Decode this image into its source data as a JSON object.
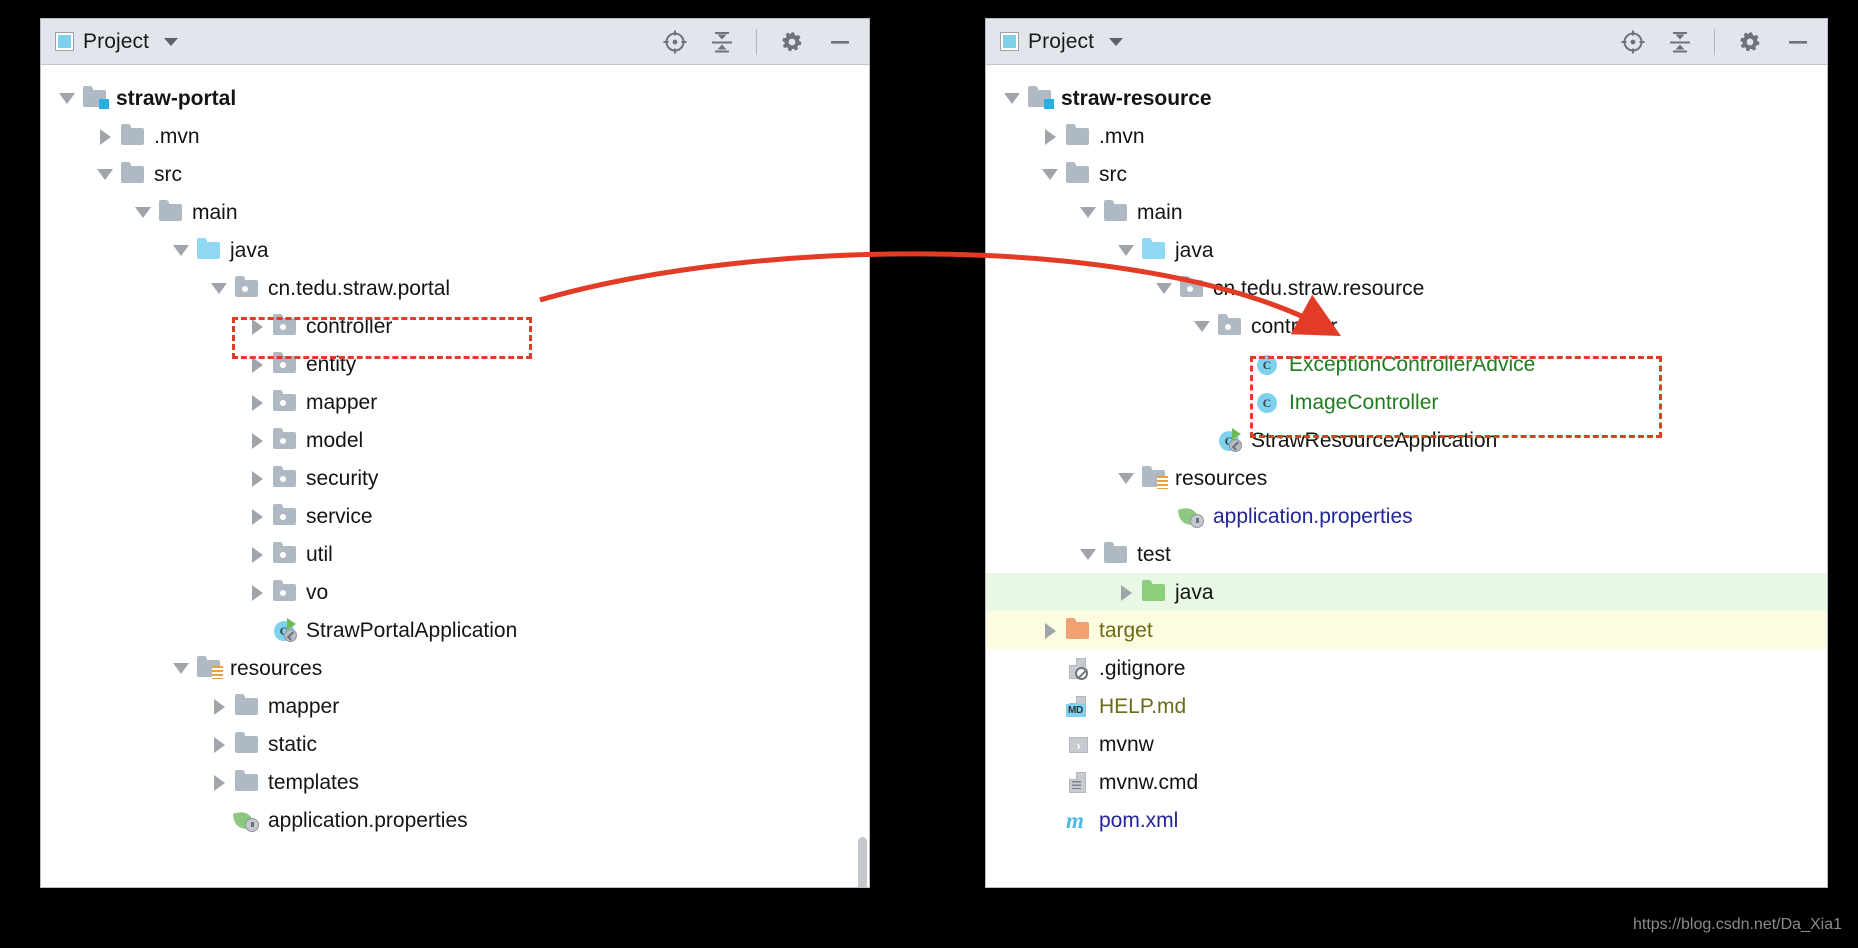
{
  "watermark": "https://blog.csdn.net/Da_Xia1",
  "accent_colors": {
    "header_bg": "#e2e5ec",
    "highlight_box": "#e23b26",
    "arrow": "#e23b26",
    "added_file_text": "#1f7d1f",
    "modified_file_text": "#23239c",
    "ignored_file_text": "#6b6b18",
    "test_row_bg": "#e9f7e5",
    "target_row_bg": "#fdfbe0"
  },
  "left_panel": {
    "header": {
      "icon": "project-window-icon",
      "title": "Project",
      "dropdown": "chevron-down-icon",
      "actions": [
        {
          "name": "select-opened-file-icon",
          "glyph": "crosshair"
        },
        {
          "name": "collapse-all-icon",
          "glyph": "collapse"
        },
        {
          "name": "settings-gear-icon",
          "glyph": "gear"
        },
        {
          "name": "hide-panel-icon",
          "glyph": "minus"
        }
      ]
    },
    "tree": [
      {
        "label": "straw-portal",
        "depth": 0,
        "twisty": "open",
        "icon": "module-folder",
        "bold": true
      },
      {
        "label": ".mvn",
        "depth": 1,
        "twisty": "closed",
        "icon": "folder"
      },
      {
        "label": "src",
        "depth": 1,
        "twisty": "open",
        "icon": "folder"
      },
      {
        "label": "main",
        "depth": 2,
        "twisty": "open",
        "icon": "folder"
      },
      {
        "label": "java",
        "depth": 3,
        "twisty": "open",
        "icon": "source-folder"
      },
      {
        "label": "cn.tedu.straw.portal",
        "depth": 4,
        "twisty": "open",
        "icon": "package-folder"
      },
      {
        "label": "controller",
        "depth": 5,
        "twisty": "closed",
        "icon": "package-folder"
      },
      {
        "label": "entity",
        "depth": 5,
        "twisty": "closed",
        "icon": "package-folder"
      },
      {
        "label": "mapper",
        "depth": 5,
        "twisty": "closed",
        "icon": "package-folder"
      },
      {
        "label": "model",
        "depth": 5,
        "twisty": "closed",
        "icon": "package-folder"
      },
      {
        "label": "security",
        "depth": 5,
        "twisty": "closed",
        "icon": "package-folder"
      },
      {
        "label": "service",
        "depth": 5,
        "twisty": "closed",
        "icon": "package-folder"
      },
      {
        "label": "util",
        "depth": 5,
        "twisty": "closed",
        "icon": "package-folder"
      },
      {
        "label": "vo",
        "depth": 5,
        "twisty": "closed",
        "icon": "package-folder"
      },
      {
        "label": "StrawPortalApplication",
        "depth": 5,
        "twisty": "none",
        "icon": "spring-class"
      },
      {
        "label": "resources",
        "depth": 3,
        "twisty": "open",
        "icon": "resources-folder"
      },
      {
        "label": "mapper",
        "depth": 4,
        "twisty": "closed",
        "icon": "folder"
      },
      {
        "label": "static",
        "depth": 4,
        "twisty": "closed",
        "icon": "folder"
      },
      {
        "label": "templates",
        "depth": 4,
        "twisty": "closed",
        "icon": "folder"
      },
      {
        "label": "application.properties",
        "depth": 4,
        "twisty": "none",
        "icon": "spring-properties"
      }
    ],
    "highlight": {
      "target_label": "controller"
    }
  },
  "right_panel": {
    "header": {
      "icon": "project-window-icon",
      "title": "Project",
      "dropdown": "chevron-down-icon",
      "actions": [
        {
          "name": "select-opened-file-icon",
          "glyph": "crosshair"
        },
        {
          "name": "collapse-all-icon",
          "glyph": "collapse"
        },
        {
          "name": "settings-gear-icon",
          "glyph": "gear"
        },
        {
          "name": "hide-panel-icon",
          "glyph": "minus"
        }
      ]
    },
    "tree": [
      {
        "label": "straw-resource",
        "depth": 0,
        "twisty": "open",
        "icon": "module-folder",
        "bold": true
      },
      {
        "label": ".mvn",
        "depth": 1,
        "twisty": "closed",
        "icon": "folder"
      },
      {
        "label": "src",
        "depth": 1,
        "twisty": "open",
        "icon": "folder"
      },
      {
        "label": "main",
        "depth": 2,
        "twisty": "open",
        "icon": "folder"
      },
      {
        "label": "java",
        "depth": 3,
        "twisty": "open",
        "icon": "source-folder"
      },
      {
        "label": "cn.tedu.straw.resource",
        "depth": 4,
        "twisty": "open",
        "icon": "package-folder"
      },
      {
        "label": "controller",
        "depth": 5,
        "twisty": "open",
        "icon": "package-folder"
      },
      {
        "label": "ExceptionControllerAdvice",
        "depth": 6,
        "twisty": "none",
        "icon": "class",
        "text_color": "added"
      },
      {
        "label": "ImageController",
        "depth": 6,
        "twisty": "none",
        "icon": "class",
        "text_color": "added"
      },
      {
        "label": "StrawResourceApplication",
        "depth": 5,
        "twisty": "none",
        "icon": "spring-class"
      },
      {
        "label": "resources",
        "depth": 3,
        "twisty": "open",
        "icon": "resources-folder"
      },
      {
        "label": "application.properties",
        "depth": 4,
        "twisty": "none",
        "icon": "spring-properties",
        "text_color": "modified"
      },
      {
        "label": "test",
        "depth": 2,
        "twisty": "open",
        "icon": "folder"
      },
      {
        "label": "java",
        "depth": 3,
        "twisty": "closed",
        "icon": "test-source-folder",
        "row_bg": "green"
      },
      {
        "label": "target",
        "depth": 1,
        "twisty": "closed",
        "icon": "target-folder",
        "row_bg": "yellow",
        "text_color": "ignored"
      },
      {
        "label": ".gitignore",
        "depth": 1,
        "twisty": "none",
        "icon": "gitignore-file"
      },
      {
        "label": "HELP.md",
        "depth": 1,
        "twisty": "none",
        "icon": "markdown-file",
        "text_color": "ignored"
      },
      {
        "label": "mvnw",
        "depth": 1,
        "twisty": "none",
        "icon": "shell-file"
      },
      {
        "label": "mvnw.cmd",
        "depth": 1,
        "twisty": "none",
        "icon": "text-file"
      },
      {
        "label": "pom.xml",
        "depth": 1,
        "twisty": "none",
        "icon": "maven-file",
        "text_color": "modified"
      }
    ],
    "highlight": {
      "target_labels": [
        "ExceptionControllerAdvice",
        "ImageController"
      ]
    }
  },
  "annotation": {
    "arrow_description": "curved red arrow from left controller package to right controller classes"
  }
}
